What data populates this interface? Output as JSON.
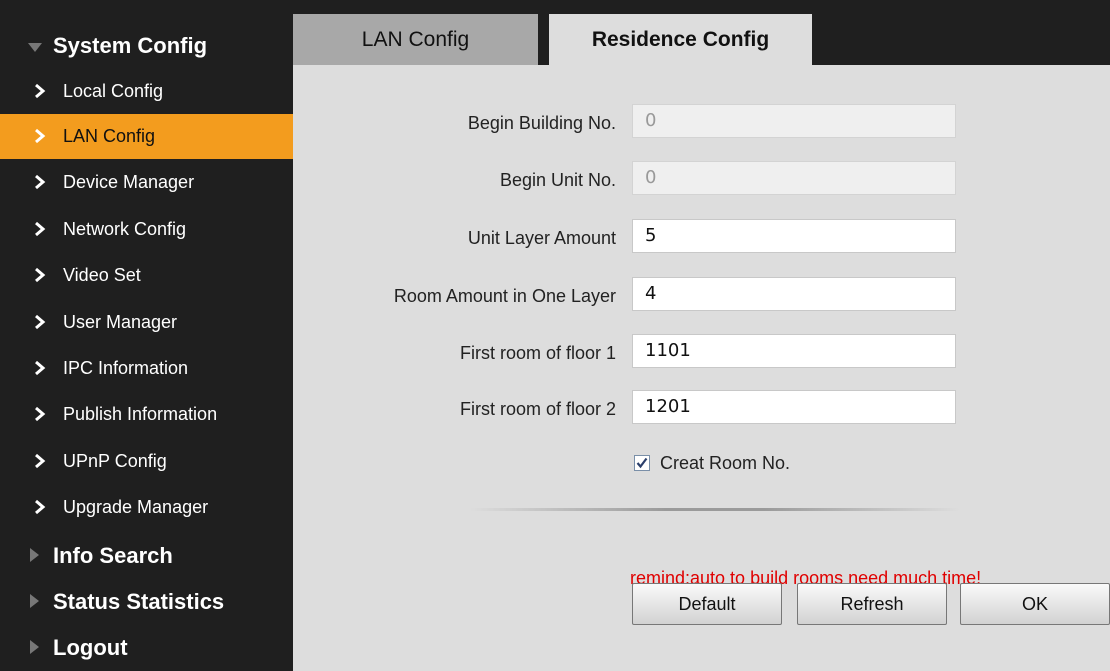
{
  "sidebar": {
    "system_config": "System Config",
    "items": [
      {
        "label": "Local Config"
      },
      {
        "label": "LAN Config"
      },
      {
        "label": "Device Manager"
      },
      {
        "label": "Network Config"
      },
      {
        "label": "Video Set"
      },
      {
        "label": "User Manager"
      },
      {
        "label": "IPC Information"
      },
      {
        "label": "Publish Information"
      },
      {
        "label": "UPnP Config"
      },
      {
        "label": "Upgrade Manager"
      }
    ],
    "info_search": "Info Search",
    "status_statistics": "Status Statistics",
    "logout": "Logout"
  },
  "tabs": {
    "lan_config": "LAN Config",
    "residence_config": "Residence Config"
  },
  "form": {
    "begin_building_label": "Begin Building No.",
    "begin_building_value": "0",
    "begin_unit_label": "Begin Unit No.",
    "begin_unit_value": "0",
    "unit_layer_label": "Unit Layer Amount",
    "unit_layer_value": "5",
    "room_amount_label": "Room Amount in One Layer",
    "room_amount_value": "4",
    "first_room_floor1_label": "First room of floor 1",
    "first_room_floor1_value": "1101",
    "first_room_floor2_label": "First room of floor 2",
    "first_room_floor2_value": "1201",
    "creat_room_label": "Creat Room No.",
    "creat_room_checked": true
  },
  "remind": "remind:auto to build rooms need much time!",
  "buttons": {
    "default": "Default",
    "refresh": "Refresh",
    "ok": "OK"
  },
  "colors": {
    "sidebar_bg": "#1f1f1f",
    "active_item": "#f39c1e",
    "content_bg": "#dddddd",
    "remind": "#e00000"
  }
}
